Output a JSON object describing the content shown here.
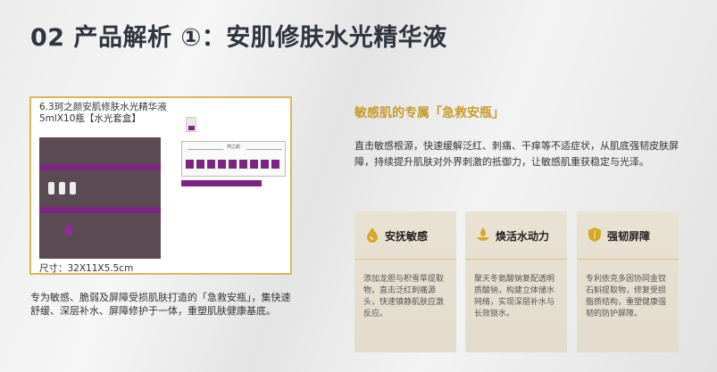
{
  "page": {
    "title": "02 产品解析 ①：安肌修肤水光精华液"
  },
  "product_card": {
    "name_line1": "6.3珂之颜安肌修肤水光精华液",
    "name_line2": "5mlX10瓶【水光套盒】",
    "size": "尺寸：32X11X5.5cm",
    "tray_logo": "珂之颜"
  },
  "product_desc": "专为敏感、脆弱及屏障受损肌肤打造的「急救安瓶」，集快速舒缓、深层补水、屏障修护于一体，重塑肌肤健康基底。",
  "right": {
    "headline": "敏感肌的专属「急救安瓶」",
    "intro": "直击敏感根源，快速缓解泛红、刺痛、干痒等不适症状，从肌底强韧皮肤屏障，持续提升肌肤对外界刺激的抵御力，让敏感肌重获稳定与光泽。"
  },
  "features": [
    {
      "icon": "drop-icon",
      "title": "安抚敏感",
      "body": "添加龙胆与积雪草提取物，直击泛红刺痛源头，快速镇静肌肤应激反应。"
    },
    {
      "icon": "hydration-icon",
      "title": "焕活水动力",
      "body": "聚天冬氨酸钠复配透明质酸钠，构建立体储水网络，实现深层补水与长效锁水。"
    },
    {
      "icon": "shield-icon",
      "title": "强韧屏障",
      "body": "专利依克多因协同金钗石斛提取物，修复受损脂质结构，重塑健康强韧的防护屏障。"
    }
  ],
  "colors": {
    "accent_gold": "#c79a2e",
    "title_dark": "#2f3440",
    "product_purple": "#7b2583"
  }
}
